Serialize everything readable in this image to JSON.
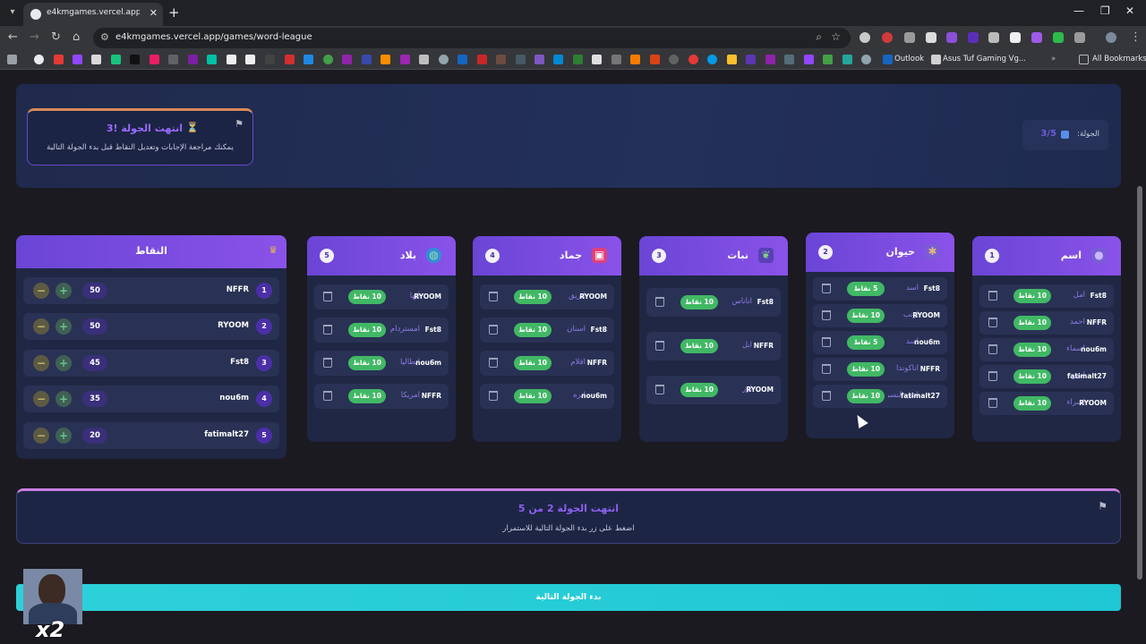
{
  "browser": {
    "tab_title": "e4kmgames.vercel.app/games/",
    "url": "e4kmgames.vercel.app/games/word-league",
    "bookmarks": {
      "outlook": "Outlook",
      "asus": "Asus Tuf Gaming Vg...",
      "all": "All Bookmarks"
    }
  },
  "header": {
    "ended_title": "انتهت الجولة !3",
    "ended_sub": "يمكنك مراجعة الإجابات وتعديل النقاط قبل بدء الجولة التالية",
    "round_label": "الجولة:",
    "round_value": "3/5"
  },
  "categories": [
    {
      "num": "1",
      "name": "اسم",
      "icon": "person-icon",
      "answers": [
        {
          "player": "Fst8",
          "word": "امل",
          "points": "10 نقاط"
        },
        {
          "player": "NFFR",
          "word": "احمد",
          "points": "10 نقاط"
        },
        {
          "player": "nou6m",
          "word": "اسماء",
          "points": "10 نقاط"
        },
        {
          "player": "fatimalt27",
          "word": "أمير",
          "points": "10 نقاط"
        },
        {
          "player": "RYOOM",
          "word": "اسراء",
          "points": "10 نقاط"
        }
      ]
    },
    {
      "num": "2",
      "name": "حيوان",
      "icon": "paw-icon",
      "answers": [
        {
          "player": "Fst8",
          "word": "اسد",
          "points": "5 نقاط"
        },
        {
          "player": "RYOOM",
          "word": "ارنب",
          "points": "10 نقاط"
        },
        {
          "player": "nou6m",
          "word": "اسد",
          "points": "5 نقاط"
        },
        {
          "player": "NFFR",
          "word": "اناكوندا",
          "points": "10 نقاط"
        },
        {
          "player": "fatimalt27",
          "word": "انثى النسر",
          "points": "10 نقاط"
        }
      ]
    },
    {
      "num": "3",
      "name": "نبات",
      "icon": "leaf-icon",
      "answers": [
        {
          "player": "Fst8",
          "word": "اناناس",
          "points": "10 نقاط"
        },
        {
          "player": "NFFR",
          "word": "ابل",
          "points": "10 نقاط"
        },
        {
          "player": "RYOOM",
          "word": "ارز",
          "points": "10 نقاط"
        }
      ]
    },
    {
      "num": "4",
      "name": "جماد",
      "icon": "box-icon",
      "answers": [
        {
          "player": "RYOOM",
          "word": "ابريق",
          "points": "10 نقاط"
        },
        {
          "player": "Fst8",
          "word": "اسنان",
          "points": "10 نقاط"
        },
        {
          "player": "NFFR",
          "word": "اقلام",
          "points": "10 نقاط"
        },
        {
          "player": "nou6m",
          "word": "ابره",
          "points": "10 نقاط"
        }
      ]
    },
    {
      "num": "5",
      "name": "بلاد",
      "icon": "globe-icon",
      "answers": [
        {
          "player": "RYOOM",
          "word": "ابها",
          "points": "10 نقاط"
        },
        {
          "player": "Fst8",
          "word": "امستردام",
          "points": "10 نقاط"
        },
        {
          "player": "nou6m",
          "word": "ايطاليا",
          "points": "10 نقاط"
        },
        {
          "player": "NFFR",
          "word": "امريكا",
          "points": "10 نقاط"
        }
      ]
    }
  ],
  "scores": {
    "title": "النقاط",
    "rows": [
      {
        "rank": "1",
        "name": "NFFR",
        "score": "50"
      },
      {
        "rank": "2",
        "name": "RYOOM",
        "score": "50"
      },
      {
        "rank": "3",
        "name": "Fst8",
        "score": "45"
      },
      {
        "rank": "4",
        "name": "nou6m",
        "score": "35"
      },
      {
        "rank": "5",
        "name": "fatimalt27",
        "score": "20"
      }
    ]
  },
  "banner": {
    "title": "انتهت الجولة 2 من 5",
    "sub": "اضغط على زر بدء الجولة التالية للاستمرار"
  },
  "next_button": "بدء الجولة التالية",
  "overlay": {
    "speed": "x2"
  }
}
